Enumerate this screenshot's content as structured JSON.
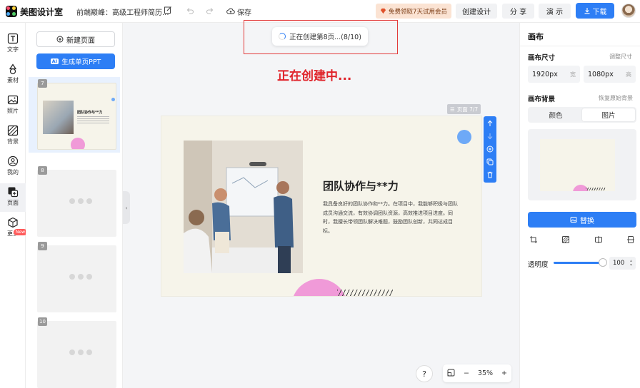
{
  "app": {
    "name": "美图设计室",
    "doc_title": "前端巅峰：高级工程师简历..."
  },
  "toolbar": {
    "save_label": "保存",
    "promo_label": "免费领取7天试用会员",
    "create_label": "创建设计",
    "share_label": "分 享",
    "present_label": "演 示",
    "download_label": "下载"
  },
  "rail": {
    "items": [
      {
        "label": "文字",
        "icon": "text-icon"
      },
      {
        "label": "素材",
        "icon": "shapes-icon"
      },
      {
        "label": "照片",
        "icon": "photo-icon"
      },
      {
        "label": "背景",
        "icon": "background-icon"
      },
      {
        "label": "我的",
        "icon": "user-icon"
      },
      {
        "label": "页面",
        "icon": "pages-icon"
      },
      {
        "label": "更多",
        "icon": "more-icon"
      }
    ],
    "new_badge": "New"
  },
  "pages_panel": {
    "new_page_label": "新建页面",
    "generate_label": "生成单页PPT",
    "ai_tag": "AI",
    "thumbnails": [
      {
        "num": "7",
        "state": "done"
      },
      {
        "num": "8",
        "state": "loading"
      },
      {
        "num": "9",
        "state": "loading"
      },
      {
        "num": "10",
        "state": "loading"
      }
    ],
    "thumb_title": "团队协作与**力"
  },
  "canvas": {
    "loading_text": "正在创建第8页...(8/10)",
    "status_overlay": "正在创建中...",
    "page_label": "页面 7/7",
    "slide": {
      "title": "团队协作与**力",
      "body": "我具备良好的团队协作和**力。在项目中，我能够积极与团队成员沟通交流，有效协调团队资源，高效推进项目进度。同时，我擅长带领团队解决难题，鼓励团队创新，共同达成目标。"
    },
    "help_label": "?",
    "zoom_value": "35%",
    "zoom_minus": "−",
    "zoom_plus": "+"
  },
  "right_panel": {
    "title": "画布",
    "size_label": "画布尺寸",
    "adjust_size": "调整尺寸",
    "width_value": "1920px",
    "width_unit": "宽",
    "height_value": "1080px",
    "height_unit": "高",
    "background_label": "画布背景",
    "restore_bg": "恢复原始背景",
    "tab_color": "颜色",
    "tab_image": "图片",
    "replace_label": "替换",
    "opacity_label": "透明度",
    "opacity_value": "100",
    "opacity_fraction": 1.0
  },
  "colors": {
    "accent": "#2d7ef5",
    "alert": "#e0242b",
    "promo_bg": "#fbe3d3",
    "slide_bg": "#f6f4ea"
  }
}
